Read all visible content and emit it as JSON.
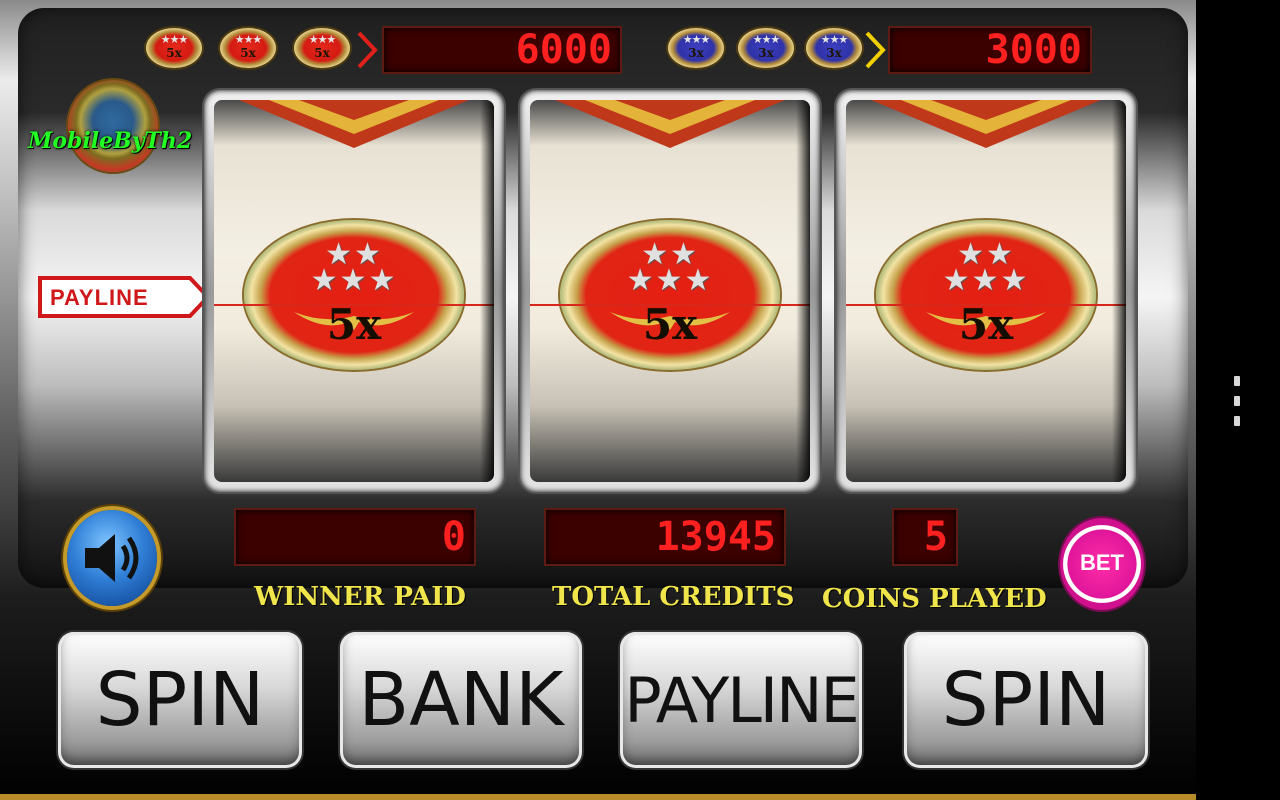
{
  "jackpots": {
    "red": {
      "coins": [
        "5x",
        "5x",
        "5x"
      ],
      "value": "6000",
      "coin_color": "red"
    },
    "blue": {
      "coins": [
        "3x",
        "3x",
        "3x"
      ],
      "value": "3000",
      "coin_color": "blue"
    }
  },
  "logo": {
    "text": "MobileByTh2"
  },
  "payline_tag": "PAYLINE",
  "reels": [
    {
      "symbol": "5x"
    },
    {
      "symbol": "5x"
    },
    {
      "symbol": "5x"
    }
  ],
  "displays": {
    "winner_paid": {
      "value": "0",
      "label": "WINNER PAID"
    },
    "total_credits": {
      "value": "13945",
      "label": "TOTAL CREDITS"
    },
    "coins_played": {
      "value": "5",
      "label": "COINS PLAYED"
    }
  },
  "bet_chip": "BET",
  "buttons": {
    "spin_left": "SPIN",
    "bank": "BANK",
    "payline": "PAYLINE",
    "spin_right": "SPIN"
  },
  "colors": {
    "led": "#ff2020",
    "label": "#f0e54a",
    "payline": "#d8281c"
  },
  "icons": [
    "speaker-icon",
    "menu-overflow-icon"
  ]
}
